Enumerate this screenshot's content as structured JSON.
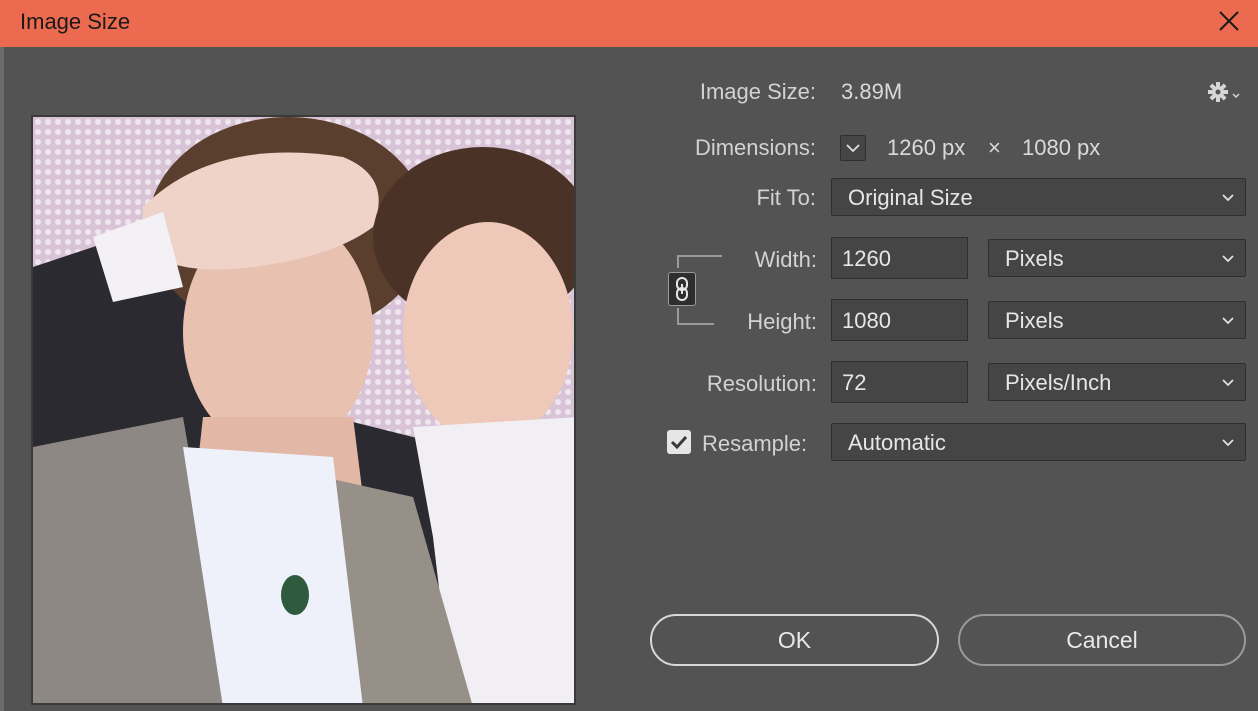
{
  "window": {
    "title": "Image Size"
  },
  "info": {
    "image_size_label": "Image Size:",
    "image_size_value": "3.89M",
    "dimensions_label": "Dimensions:",
    "dim_width": "1260 px",
    "dim_times": "×",
    "dim_height": "1080 px"
  },
  "fit_to": {
    "label": "Fit To:",
    "value": "Original Size"
  },
  "width": {
    "label": "Width:",
    "value": "1260",
    "unit": "Pixels"
  },
  "height": {
    "label": "Height:",
    "value": "1080",
    "unit": "Pixels"
  },
  "resolution": {
    "label": "Resolution:",
    "value": "72",
    "unit": "Pixels/Inch"
  },
  "resample": {
    "label": "Resample:",
    "checked": true,
    "value": "Automatic"
  },
  "buttons": {
    "ok": "OK",
    "cancel": "Cancel"
  },
  "colors": {
    "titlebar": "#ec6a4f",
    "dialog_bg": "#535353",
    "field_bg": "#454545"
  }
}
